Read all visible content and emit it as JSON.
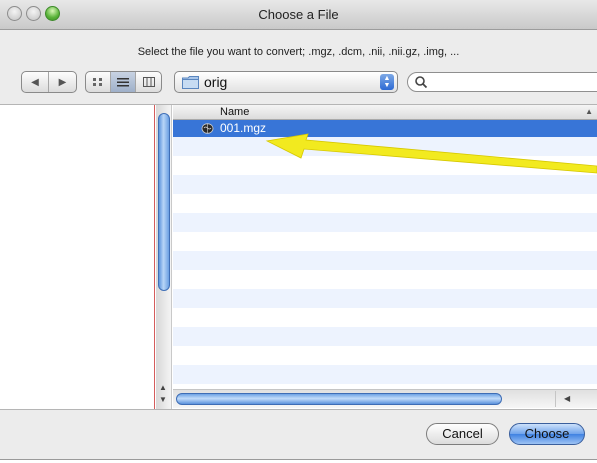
{
  "window": {
    "title": "Choose a File"
  },
  "prompt": "Select the file you want to convert; .mgz, .dcm, .nii, .nii.gz, .img, ...",
  "toolbar": {
    "back_label": "◀",
    "forward_label": "▶",
    "view_modes": [
      "icon-view",
      "list-view",
      "column-view"
    ],
    "active_view": "list-view",
    "location": "orig",
    "search_placeholder": ""
  },
  "list": {
    "column_header": "Name",
    "files": [
      {
        "name": "001.mgz",
        "icon": "brain-file-icon",
        "selected": true
      }
    ]
  },
  "buttons": {
    "cancel": "Cancel",
    "choose": "Choose"
  },
  "colors": {
    "selection": "#3875d7",
    "arrow": "#f0e81c",
    "accent": "#3f82e2"
  }
}
